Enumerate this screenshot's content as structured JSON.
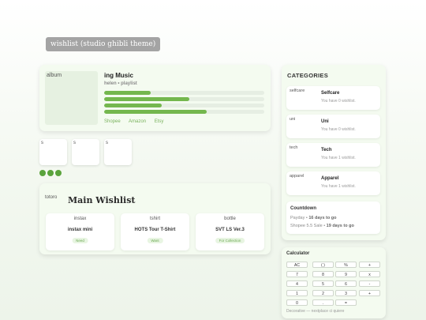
{
  "page": {
    "title": "wishlist (studio ghibli theme)"
  },
  "music": {
    "album_alt": "album",
    "title": "ing Music",
    "subtitle": "helen • playlist",
    "progress": [
      0.29,
      0.53,
      0.36,
      0.64
    ],
    "links": [
      "Shopee",
      "Amazon",
      "Etsy"
    ]
  },
  "thumbs": [
    "s",
    "s",
    "s"
  ],
  "wishlist": {
    "icon_alt": "totoro",
    "title": "Main Wishlist",
    "items": [
      {
        "img": "instax",
        "name": "instax mini",
        "tag": "Need"
      },
      {
        "img": "tshirt",
        "name": "HOTS Tour T-Shirt",
        "tag": "Want"
      },
      {
        "img": "bottle",
        "name": "SVT LS Ver.3",
        "tag": "For Collection"
      }
    ]
  },
  "categories": {
    "heading": "CATEGORIES",
    "items": [
      {
        "img": "selfcare",
        "name": "Selfcare",
        "status": "You have 0 wishlist."
      },
      {
        "img": "uni",
        "name": "Uni",
        "status": "You have 0 wishlist."
      },
      {
        "img": "tech",
        "name": "Tech",
        "status": "You have 1 wishlist."
      },
      {
        "img": "apparel",
        "name": "Apparel",
        "status": "You have 1 wishlist."
      }
    ]
  },
  "countdown": {
    "heading": "Countdown",
    "items": [
      {
        "label": "Payday",
        "value": "16 days to go"
      },
      {
        "label": "Shopee 5.5 Sale",
        "value": "19 days to go"
      }
    ]
  },
  "calculator": {
    "heading": "Calculator",
    "keys": [
      [
        "AC",
        "( )",
        "%",
        "+"
      ],
      [
        "7",
        "8",
        "9",
        "x"
      ],
      [
        "4",
        "5",
        "6",
        "-"
      ],
      [
        "1",
        "2",
        "3",
        "+"
      ],
      [
        "0",
        ".",
        "=",
        ""
      ]
    ],
    "note": "Decorative — nextplace ci quiere"
  }
}
